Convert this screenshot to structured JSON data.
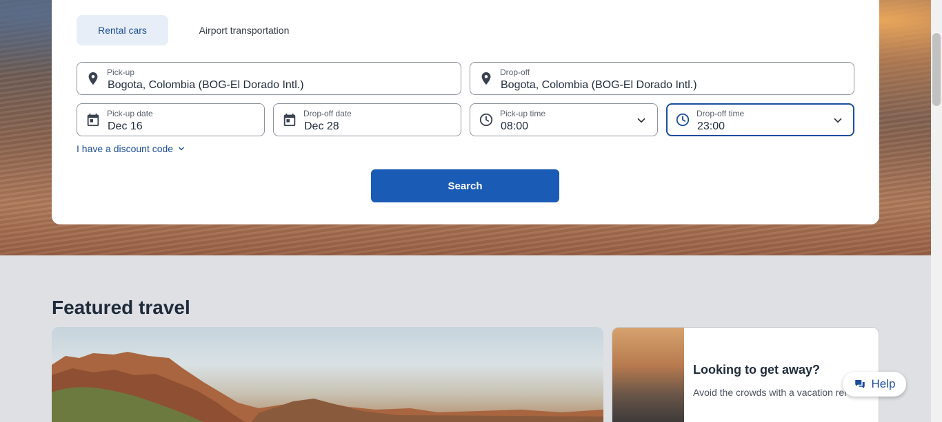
{
  "tabs": {
    "rental_cars": "Rental cars",
    "airport_transportation": "Airport transportation"
  },
  "pickup": {
    "label": "Pick-up",
    "value": "Bogota, Colombia (BOG-El Dorado Intl.)"
  },
  "dropoff": {
    "label": "Drop-off",
    "value": "Bogota, Colombia (BOG-El Dorado Intl.)"
  },
  "pickup_date": {
    "label": "Pick-up date",
    "value": "Dec 16"
  },
  "dropoff_date": {
    "label": "Drop-off date",
    "value": "Dec 28"
  },
  "pickup_time": {
    "label": "Pick-up time",
    "value": "08:00"
  },
  "dropoff_time": {
    "label": "Drop-off time",
    "value": "23:00"
  },
  "discount_link": "I have a discount code",
  "search_button": "Search",
  "featured": {
    "title": "Featured travel",
    "side_card": {
      "title": "Looking to get away?",
      "text": "Avoid the crowds with a vacation rei"
    }
  },
  "help_button": "Help",
  "colors": {
    "primary": "#1a5bb5",
    "accent_text": "#1c4d9a",
    "tab_active_bg": "#e7eef8"
  },
  "icons": {
    "location": "map-pin-icon",
    "date": "calendar-icon",
    "time": "clock-icon",
    "expand": "chevron-down-icon",
    "help": "chat-icon"
  }
}
